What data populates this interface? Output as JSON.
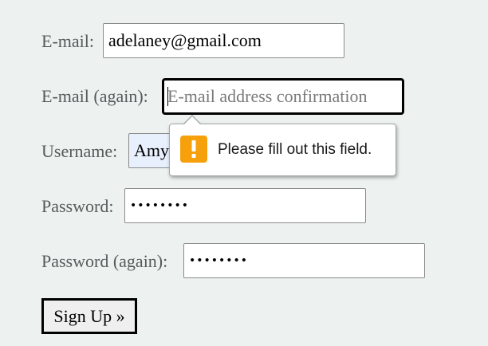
{
  "form": {
    "email": {
      "label": "E-mail:",
      "value": "adelaney@gmail.com"
    },
    "email_again": {
      "label": "E-mail (again):",
      "value": "",
      "placeholder": "E-mail address confirmation"
    },
    "username": {
      "label": "Username:",
      "value": "Amy"
    },
    "password": {
      "label": "Password:",
      "value": "••••••••"
    },
    "password_again": {
      "label": "Password (again):",
      "value": "••••••••"
    },
    "submit_label": "Sign Up »"
  },
  "validation": {
    "message": "Please fill out this field.",
    "icon": "warning-icon",
    "icon_color": "#f6a10b"
  },
  "colors": {
    "background": "#edf2f1",
    "label_text": "#555b5b",
    "autofill_bg": "#e8effd"
  }
}
